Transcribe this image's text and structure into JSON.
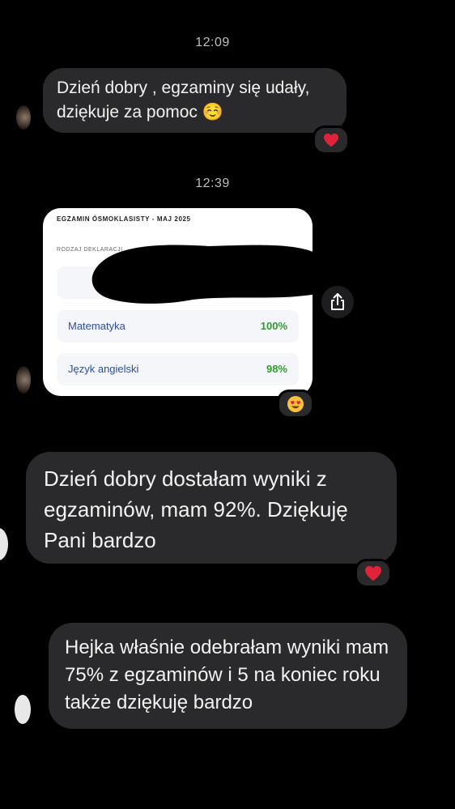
{
  "chat": {
    "timestamp_1": "12:09",
    "message_1": "Dzień dobry , egzaminy się udały, dziękuje za pomoc ☺️",
    "message_1_reaction": "heart-emoji",
    "timestamp_2": "12:39",
    "attachment": {
      "header": "EGZAMIN ÓSMOKLASISTY - MAJ 2025",
      "sub_label": "RODZAJ DEKLARACJI",
      "rows": [
        {
          "subject": "Matematyka",
          "result": "100%"
        },
        {
          "subject": "Język angielski",
          "result": "98%"
        }
      ],
      "reaction": "heart-eyes-emoji"
    },
    "message_2": "Dzień dobry dostałam wyniki z egzaminów, mam 92%. Dziękuję Pani bardzo",
    "message_2_reaction": "heart-emoji",
    "message_3": "Hejka właśnie odebrałam wyniki mam 75% z egzaminów i 5 na koniec roku także dziękuję bardzo"
  },
  "colors": {
    "background": "#000000",
    "bubble": "#2a2a2c",
    "heart": "#e0233a",
    "subject_blue": "#2d4f9e",
    "result_green": "#2d9d2d"
  }
}
